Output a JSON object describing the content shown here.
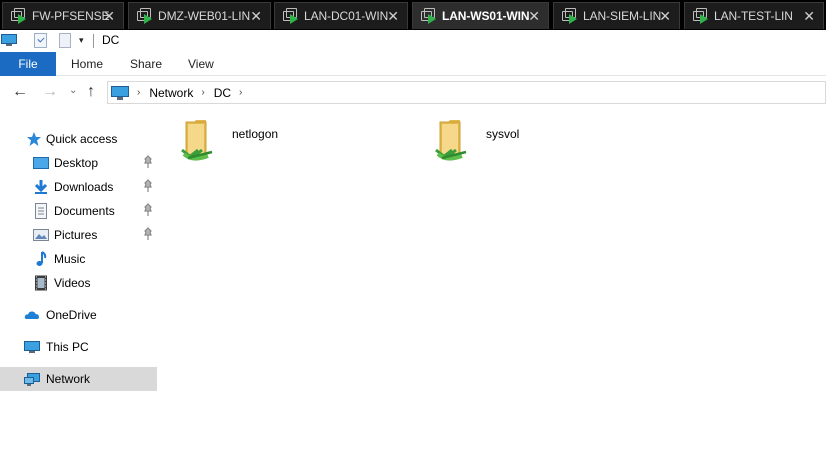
{
  "vm_tabs": [
    {
      "label": "FW-PFSENSE",
      "active": false
    },
    {
      "label": "DMZ-WEB01-LIN",
      "active": false
    },
    {
      "label": "LAN-DC01-WIN",
      "active": false
    },
    {
      "label": "LAN-WS01-WIN",
      "active": true
    },
    {
      "label": "LAN-SIEM-LIN",
      "active": false
    },
    {
      "label": "LAN-TEST-LIN",
      "active": false
    }
  ],
  "close_glyph": "✕",
  "window_title": "DC",
  "ribbon": {
    "file": "File",
    "home": "Home",
    "share": "Share",
    "view": "View"
  },
  "address": {
    "breadcrumbs": [
      "Network",
      "DC"
    ],
    "separator": "›"
  },
  "nav_buttons": {
    "back": "←",
    "forward": "→",
    "recent": "⌄",
    "up": "↑"
  },
  "navigation_pane": {
    "quick_access": "Quick access",
    "pinned": [
      {
        "label": "Desktop",
        "icon": "desktop-icon",
        "pinned": true
      },
      {
        "label": "Downloads",
        "icon": "downloads-icon",
        "pinned": true
      },
      {
        "label": "Documents",
        "icon": "documents-icon",
        "pinned": true
      },
      {
        "label": "Pictures",
        "icon": "pictures-icon",
        "pinned": true
      },
      {
        "label": "Music",
        "icon": "music-icon",
        "pinned": false
      },
      {
        "label": "Videos",
        "icon": "videos-icon",
        "pinned": false
      }
    ],
    "onedrive": "OneDrive",
    "this_pc": "This PC",
    "network": "Network",
    "selected": "Network"
  },
  "shares": [
    {
      "name": "netlogon",
      "icon": "shared-folder-icon"
    },
    {
      "name": "sysvol",
      "icon": "shared-folder-icon"
    }
  ],
  "colors": {
    "file_tab": "#1a6bc1",
    "vm_tab_bar": "#000000",
    "selected_nav": "#d9d9d9",
    "running_indicator": "#2fb34a"
  }
}
